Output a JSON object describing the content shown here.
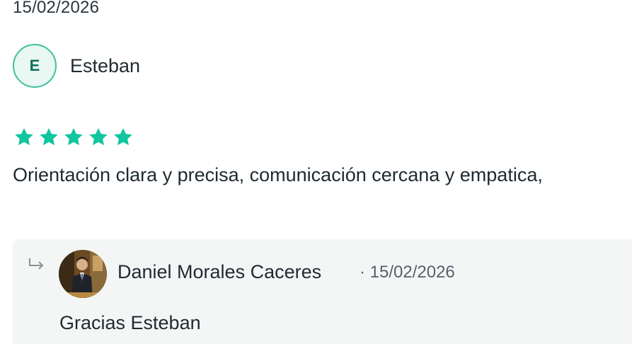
{
  "review": {
    "date": "15/02/2026",
    "author_initial": "E",
    "author_name": "Esteban",
    "rating": 5,
    "text": "Orientación clara y precisa, comunicación cercana y empatica,"
  },
  "reply": {
    "author_name": "Daniel Morales Caceres",
    "date": "· 15/02/2026",
    "text": "Gracias Esteban"
  },
  "colors": {
    "star": "#11c5a0",
    "avatar_border": "#3fbf9d",
    "reply_bg": "#f4f6f6"
  },
  "icons": {
    "star": "star-icon",
    "reply": "reply-arrow-icon"
  }
}
